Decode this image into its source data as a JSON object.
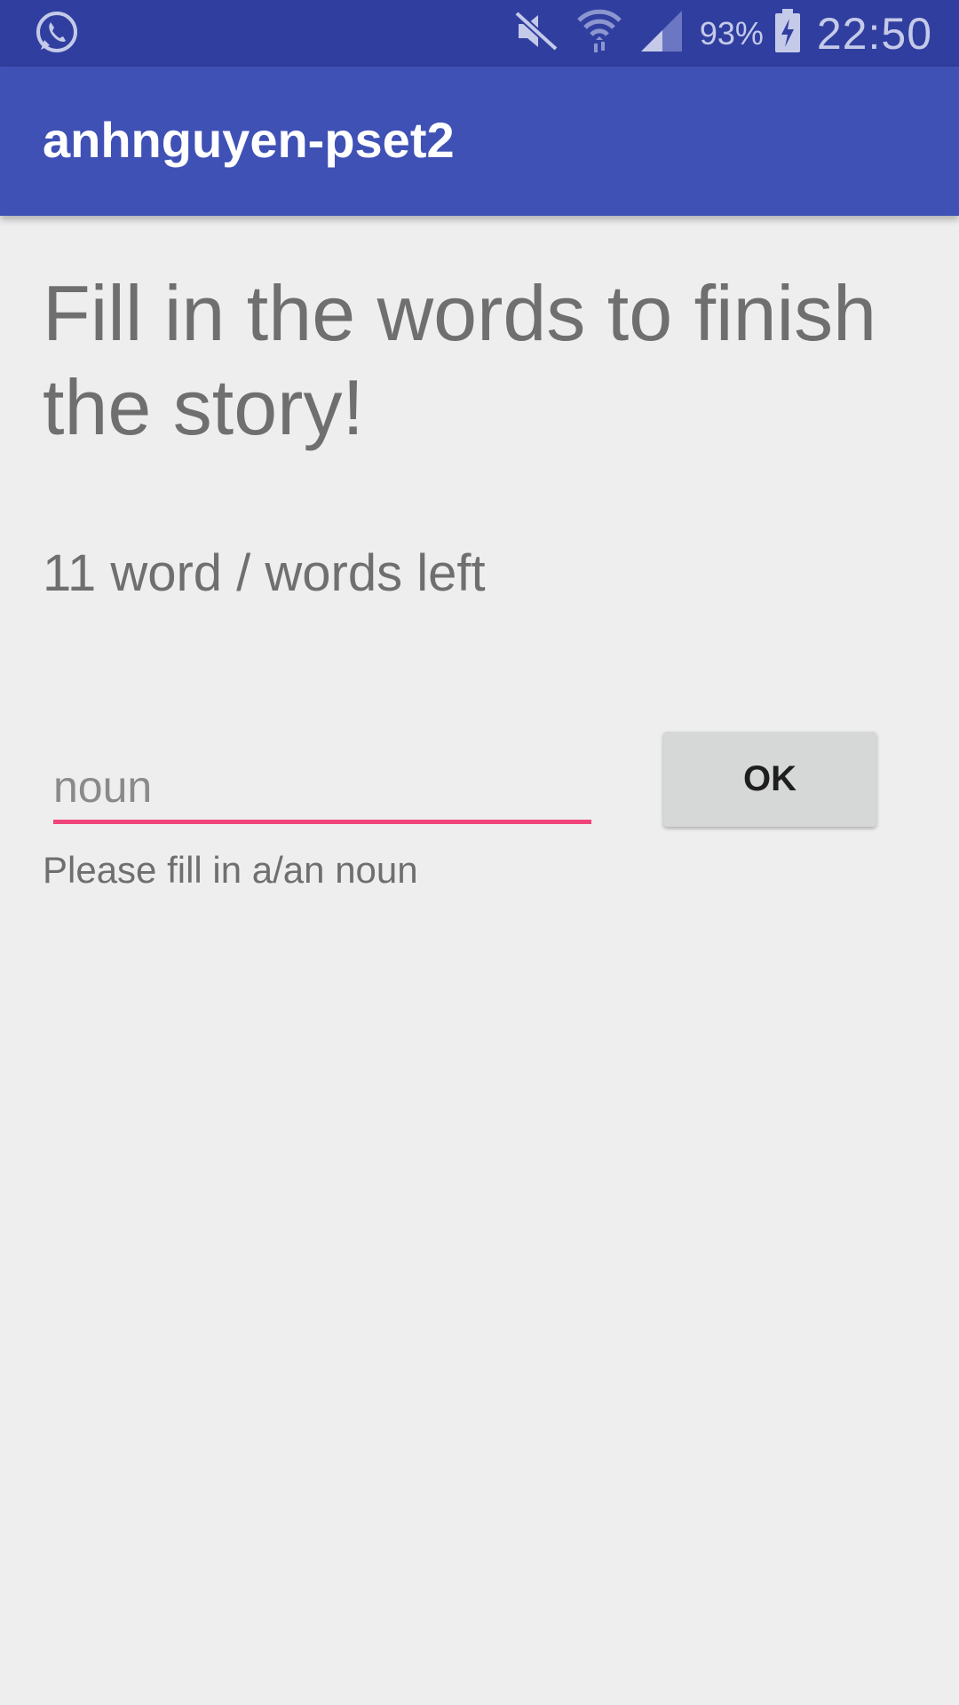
{
  "status_bar": {
    "battery_percent": "93%",
    "time": "22:50",
    "icons": [
      "whatsapp-icon",
      "mute-icon",
      "wifi-icon",
      "signal-icon",
      "battery-charging-icon"
    ]
  },
  "app_bar": {
    "title": "anhnguyen-pset2"
  },
  "main": {
    "heading": "Fill in the words to finish the story!",
    "words_left": "11 word / words left",
    "input_placeholder": "noun",
    "input_value": "",
    "ok_label": "OK",
    "hint": "Please fill in a/an noun"
  },
  "colors": {
    "status_bar": "#303F9F",
    "app_bar": "#3F51B5",
    "accent": "#F0457A",
    "background": "#EEEEEF",
    "button": "#D6D7D7"
  }
}
